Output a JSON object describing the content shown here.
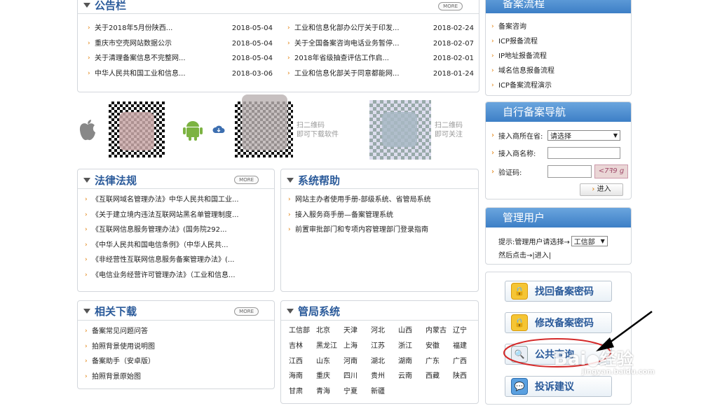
{
  "announcement": {
    "title": "公告栏",
    "more": "MORE",
    "left": [
      {
        "text": "关于2018年5月份陕西...",
        "date": "2018-05-04"
      },
      {
        "text": "重庆市空壳网站数据公示",
        "date": "2018-05-04"
      },
      {
        "text": "关于清理备案信息不完整网...",
        "date": "2018-05-04"
      },
      {
        "text": "中华人民共和国工业和信息...",
        "date": "2018-03-06"
      }
    ],
    "right": [
      {
        "text": "工业和信息化部办公厅关于印发...",
        "date": "2018-02-24"
      },
      {
        "text": "关于全国备案咨询电话业务暂停...",
        "date": "2018-02-07"
      },
      {
        "text": "2018年省级抽查评估工作启...",
        "date": "2018-02-01"
      },
      {
        "text": "工业和信息化部关于同意都能网...",
        "date": "2018-01-24"
      }
    ]
  },
  "apps": {
    "qr2_caption_line1": "扫二维码",
    "qr2_caption_line2": "即可下载软件",
    "qr3_caption_line1": "扫二维码",
    "qr3_caption_line2": "即可关注"
  },
  "law": {
    "title": "法律法规",
    "more": "MORE",
    "items": [
      "《互联网域名管理办法》中华人民共和国工业...",
      "《关于建立境内违法互联网站黑名单管理制度...",
      "《互联网信息服务管理办法》(国务院292...",
      "《中华人民共和国电信条例》（中华人民共...",
      "《非经营性互联网信息服务备案管理办法》(...",
      "《电信业务经营许可管理办法》（工业和信息..."
    ]
  },
  "help": {
    "title": "系统帮助",
    "items": [
      "网站主办者使用手册-部级系统、省管局系统",
      "接入服务商手册—备案管理系统",
      "前置审批部门和专项内容管理部门登录指南"
    ]
  },
  "download": {
    "title": "相关下载",
    "more": "MORE",
    "items": [
      "备案常见问题问答",
      "拍照背景使用说明图",
      "备案助手（安卓版）",
      "拍照背景原始图"
    ]
  },
  "bureau": {
    "title": "管局系统",
    "provinces": [
      "工信部",
      "北京",
      "天津",
      "河北",
      "山西",
      "内蒙古",
      "辽宁",
      "吉林",
      "黑龙江",
      "上海",
      "江苏",
      "浙江",
      "安徽",
      "福建",
      "江西",
      "山东",
      "河南",
      "湖北",
      "湖南",
      "广东",
      "广西",
      "海南",
      "重庆",
      "四川",
      "贵州",
      "云南",
      "西藏",
      "陕西",
      "甘肃",
      "青海",
      "宁夏",
      "新疆"
    ]
  },
  "process": {
    "title": "备案流程",
    "items": [
      "备案咨询",
      "ICP报备流程",
      "IP地址报备流程",
      "域名信息报备流程",
      "ICP备案流程演示"
    ]
  },
  "selfnav": {
    "title": "自行备案导航",
    "location_label": "接入商所在省:",
    "location_value": "请选择",
    "name_label": "接入商名称:",
    "name_value": "",
    "captcha_label": "验证码:",
    "captcha_value": "",
    "captcha_text": "<7ꟻ9 g",
    "enter": "进入"
  },
  "admin": {
    "title": "管理用户",
    "prompt": "提示:管理用户请选择→",
    "select_value": "工信部",
    "then_click": "然后点击→",
    "enter_link": "|进入|"
  },
  "actions": {
    "retrieve": "找回备案密码",
    "modify": "修改备案密码",
    "query": "公共查询",
    "suggest": "投诉建议"
  },
  "watermark": {
    "brand": "Bai",
    "cn": "经验",
    "url": "jingyan.baidu.com"
  },
  "colors": {
    "accent": "#2a5a9a",
    "title_bar": "#3d7fc6",
    "bullet": "#e07a00",
    "annotation": "#d42a2a"
  }
}
